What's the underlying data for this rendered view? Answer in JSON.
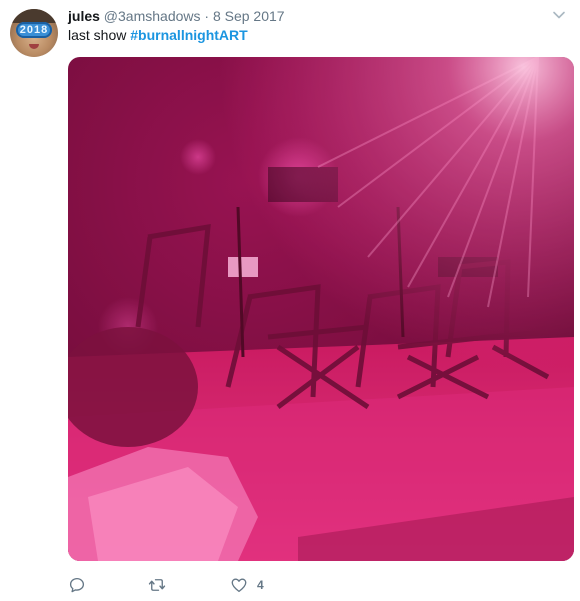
{
  "tweet": {
    "author": {
      "display_name": "jules",
      "handle": "@3amshadows",
      "avatar_text": "2018"
    },
    "separator": "·",
    "date": "8 Sep 2017",
    "text_prefix": "last show ",
    "hashtag": "#burnallnightART",
    "media_icon": "photo",
    "actions": {
      "reply_icon": "reply-icon",
      "retweet_icon": "retweet-icon",
      "like_icon": "heart-icon",
      "like_count": "4"
    },
    "colors": {
      "hashtag": "#1b95e0",
      "secondary_text": "#657786",
      "primary_text": "#14171a"
    }
  }
}
